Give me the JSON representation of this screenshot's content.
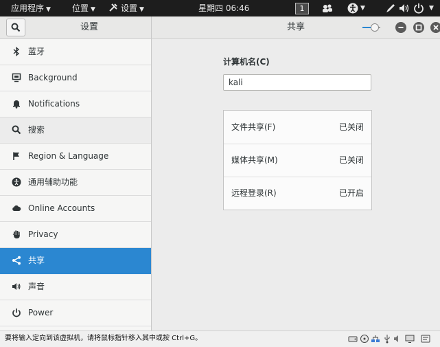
{
  "topbar": {
    "applications": "应用程序",
    "places": "位置",
    "settings": "设置",
    "clock": "星期四 06:46",
    "workspace": "1"
  },
  "window": {
    "sidebar_title": "设置",
    "panel_title": "共享"
  },
  "sidebar": {
    "items": [
      {
        "label": "蓝牙",
        "icon": "bluetooth-icon"
      },
      {
        "label": "Background",
        "icon": "background-icon"
      },
      {
        "label": "Notifications",
        "icon": "bell-icon"
      },
      {
        "label": "搜索",
        "icon": "search-icon"
      },
      {
        "label": "Region & Language",
        "icon": "flag-icon"
      },
      {
        "label": "通用辅助功能",
        "icon": "accessibility-icon"
      },
      {
        "label": "Online Accounts",
        "icon": "cloud-icon"
      },
      {
        "label": "Privacy",
        "icon": "hand-icon"
      },
      {
        "label": "共享",
        "icon": "share-icon"
      },
      {
        "label": "声音",
        "icon": "speaker-icon"
      },
      {
        "label": "Power",
        "icon": "power-icon"
      }
    ],
    "active": "共享"
  },
  "sharing": {
    "computer_name_label": "计算机名(C)",
    "computer_name_value": "kali",
    "services": [
      {
        "name": "文件共享(F)",
        "status": "已关闭"
      },
      {
        "name": "媒体共享(M)",
        "status": "已关闭"
      },
      {
        "name": "远程登录(R)",
        "status": "已开启"
      }
    ]
  },
  "statusbar": {
    "message": "要将输入定向到该虚拟机，请将鼠标指针移入其中或按 Ctrl+G。"
  },
  "colors": {
    "accent": "#2b87d1",
    "topbar": "#1d1d1d"
  }
}
